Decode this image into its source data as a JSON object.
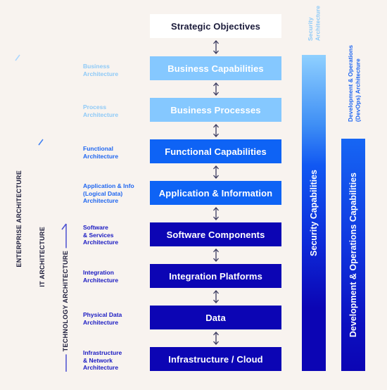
{
  "layers": [
    {
      "label": "Strategic Objectives",
      "style": "white"
    },
    {
      "label": "Business Capabilities",
      "style": "light"
    },
    {
      "label": "Business Processes",
      "style": "light"
    },
    {
      "label": "Functional Capabilities",
      "style": "mid"
    },
    {
      "label": "Application & Information",
      "style": "mid"
    },
    {
      "label": "Software Components",
      "style": "dark"
    },
    {
      "label": "Integration Platforms",
      "style": "dark"
    },
    {
      "label": "Data",
      "style": "dark"
    },
    {
      "label": "Infrastructure / Cloud",
      "style": "dark"
    }
  ],
  "architectures": [
    {
      "label": "Business\nArchitecture",
      "lines": [
        "Business",
        "Architecture"
      ]
    },
    {
      "lines": [
        "Process",
        "Architecture"
      ]
    },
    {
      "lines": [
        "Functional",
        "Architecture"
      ]
    },
    {
      "lines": [
        "Application & Info",
        "(Logical Data)",
        "Architecture"
      ]
    },
    {
      "lines": [
        "Software",
        "& Services",
        "Architecture"
      ]
    },
    {
      "lines": [
        "Integration",
        "Architecture"
      ]
    },
    {
      "lines": [
        "Physical Data",
        "Architecture"
      ]
    },
    {
      "lines": [
        "Infrastructure",
        "& Network",
        "Architecture"
      ]
    }
  ],
  "scopes": {
    "enterprise": "ENTERPRISE ARCHITECTURE",
    "it": "IT ARCHITECTURE",
    "technology": "TECHNOLOGY ARCHITECTURE"
  },
  "columns": {
    "security": {
      "heading_lines": [
        "Security",
        "Architecture"
      ],
      "bar_label": "Security Capabilities"
    },
    "devops": {
      "heading_lines": [
        "Development & Operations",
        "(DevOps) Architecture"
      ],
      "bar_label": "Development & Operations Capabilities"
    }
  },
  "colors": {
    "background": "#f8f3ef",
    "light_blue": "#85c8ff",
    "mid_blue": "#0e63f5",
    "dark_blue": "#0c05b4",
    "text_dark": "#1b1b3a"
  }
}
